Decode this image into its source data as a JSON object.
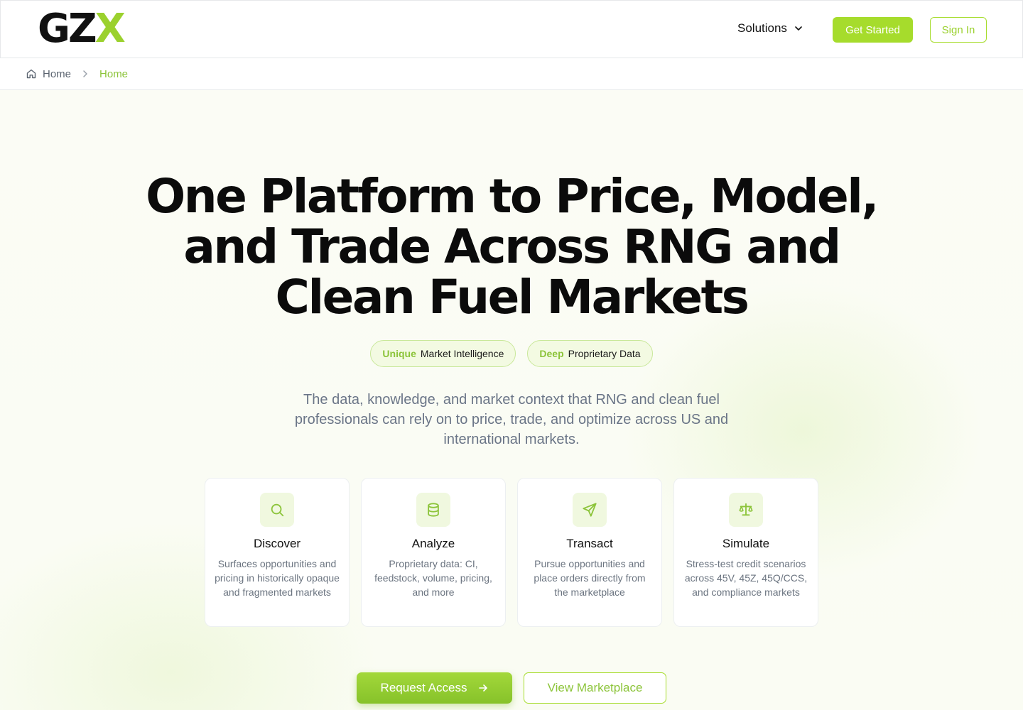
{
  "brand": {
    "logo_main": "GZ",
    "logo_accent": "X"
  },
  "nav": {
    "solutions_label": "Solutions",
    "get_started_label": "Get Started",
    "sign_in_label": "Sign In"
  },
  "breadcrumb": {
    "home_label": "Home",
    "current_label": "Home"
  },
  "hero": {
    "title_line1": "One Platform to Price, Model,",
    "title_line2": "and Trade Across RNG and",
    "title_line3": "Clean Fuel Markets",
    "pills": [
      {
        "accent": "Unique",
        "text": "Market Intelligence"
      },
      {
        "accent": "Deep",
        "text": "Proprietary Data"
      }
    ],
    "subtitle": "The data, knowledge, and market context that RNG and clean fuel professionals can rely on to price, trade, and optimize across US and international markets."
  },
  "features": [
    {
      "icon": "search-icon",
      "title": "Discover",
      "description": "Surfaces opportunities and pricing in historically opaque and fragmented markets"
    },
    {
      "icon": "database-icon",
      "title": "Analyze",
      "description": "Proprietary data: CI, feedstock, volume, pricing, and more"
    },
    {
      "icon": "send-icon",
      "title": "Transact",
      "description": "Pursue opportunities and place orders directly from the marketplace"
    },
    {
      "icon": "scale-icon",
      "title": "Simulate",
      "description": "Stress-test credit scenarios across 45V, 45Z, 45Q/CCS, and compliance markets"
    }
  ],
  "cta": {
    "request_access_label": "Request Access",
    "view_marketplace_label": "View Marketplace"
  },
  "colors": {
    "accent": "#a6dc2c",
    "accent_text": "#8cc43a",
    "text_muted": "#6a7587"
  }
}
